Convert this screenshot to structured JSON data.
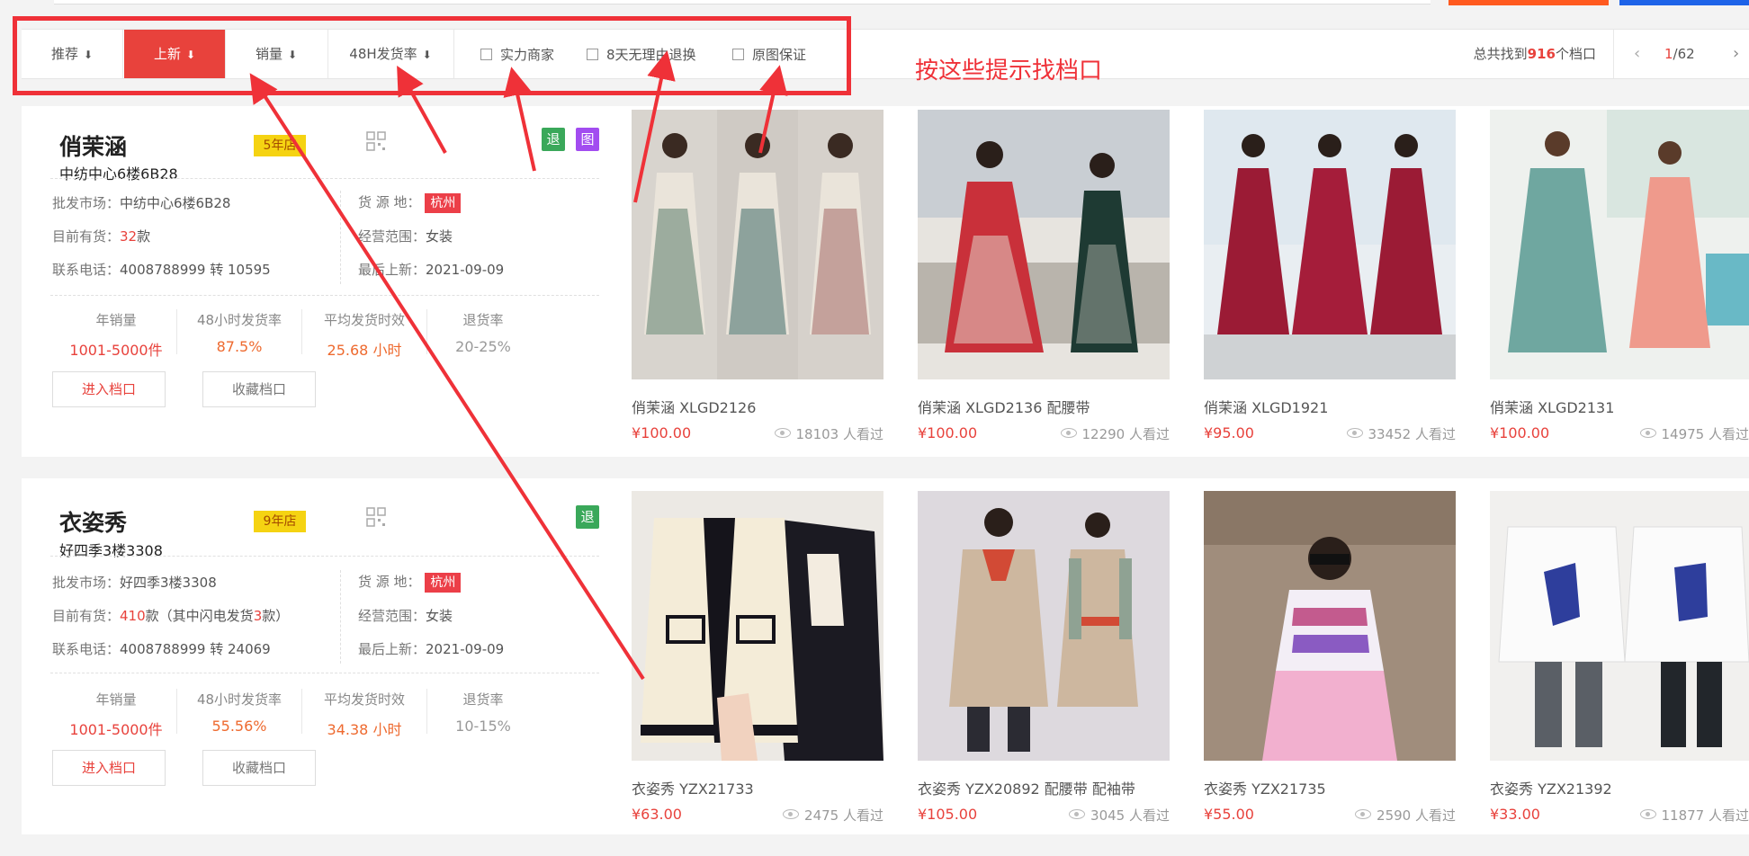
{
  "filter_bar": {
    "sorts": [
      {
        "label": "推荐",
        "arrow": "⬇",
        "active": false
      },
      {
        "label": "上新",
        "arrow": "⬇",
        "active": true
      },
      {
        "label": "销量",
        "arrow": "⬇",
        "active": false
      },
      {
        "label": "48H发货率",
        "arrow": "⬇",
        "active": false
      }
    ],
    "checkboxes": [
      "实力商家",
      "8天无理由退换",
      "原图保证"
    ],
    "total_prefix": "总共找到",
    "total_count": "916",
    "total_suffix": "个档口",
    "page_current": "1",
    "page_total": "/62",
    "prev": "‹",
    "next": "›"
  },
  "annotation": {
    "text": "按这些提示找档口",
    "color": "#ef3138"
  },
  "shops": [
    {
      "name": "俏茉涵",
      "years": "5年店",
      "address": "中纺中心6楼6B28",
      "badges": [
        "退",
        "图"
      ],
      "market_label": "批发市场：",
      "market": "中纺中心6楼6B28",
      "origin_label": "货 源 地：",
      "origin": "杭州",
      "stock_label": "目前有货：",
      "stock_num": "32",
      "stock_unit": "款",
      "stock_extra": "",
      "scope_label": "经营范围：",
      "scope": "女装",
      "phone_label": "联系电话：",
      "phone": "4008788999 转 10595",
      "latest_label": "最后上新：",
      "latest": "2021-09-09",
      "stats": [
        {
          "label": "年销量",
          "value": "1001-5000件"
        },
        {
          "label": "48小时发货率",
          "value": "87.5%"
        },
        {
          "label": "平均发货时效",
          "value": "25.68 小时"
        },
        {
          "label": "退货率",
          "value": "20-25%"
        }
      ],
      "enter_label": "进入档口",
      "fav_label": "收藏档口",
      "products": [
        {
          "title": "俏茉涵 XLGD2126",
          "price": "¥100.00",
          "views": "18103 人看过"
        },
        {
          "title": "俏茉涵 XLGD2136 配腰带",
          "price": "¥100.00",
          "views": "12290 人看过"
        },
        {
          "title": "俏茉涵 XLGD1921",
          "price": "¥95.00",
          "views": "33452 人看过"
        },
        {
          "title": "俏茉涵 XLGD2131",
          "price": "¥100.00",
          "views": "14975 人看过"
        }
      ]
    },
    {
      "name": "衣姿秀",
      "years": "9年店",
      "address": "好四季3楼3308",
      "badges": [
        "退"
      ],
      "market_label": "批发市场：",
      "market": "好四季3楼3308",
      "origin_label": "货 源 地：",
      "origin": "杭州",
      "stock_label": "目前有货：",
      "stock_num": "410",
      "stock_unit": "款",
      "stock_extra_pre": "（其中闪电发货",
      "stock_extra_num": "3",
      "stock_extra_post": "款）",
      "scope_label": "经营范围：",
      "scope": "女装",
      "phone_label": "联系电话：",
      "phone": "4008788999 转 24069",
      "latest_label": "最后上新：",
      "latest": "2021-09-09",
      "stats": [
        {
          "label": "年销量",
          "value": "1001-5000件"
        },
        {
          "label": "48小时发货率",
          "value": "55.56%"
        },
        {
          "label": "平均发货时效",
          "value": "34.38 小时"
        },
        {
          "label": "退货率",
          "value": "10-15%"
        }
      ],
      "enter_label": "进入档口",
      "fav_label": "收藏档口",
      "products": [
        {
          "title": "衣姿秀 YZX21733",
          "price": "¥63.00",
          "views": "2475 人看过"
        },
        {
          "title": "衣姿秀 YZX20892 配腰带 配袖带",
          "price": "¥105.00",
          "views": "3045 人看过"
        },
        {
          "title": "衣姿秀 YZX21735",
          "price": "¥55.00",
          "views": "2590 人看过"
        },
        {
          "title": "衣姿秀 YZX21392",
          "price": "¥33.00",
          "views": "11877 人看过"
        }
      ]
    }
  ]
}
